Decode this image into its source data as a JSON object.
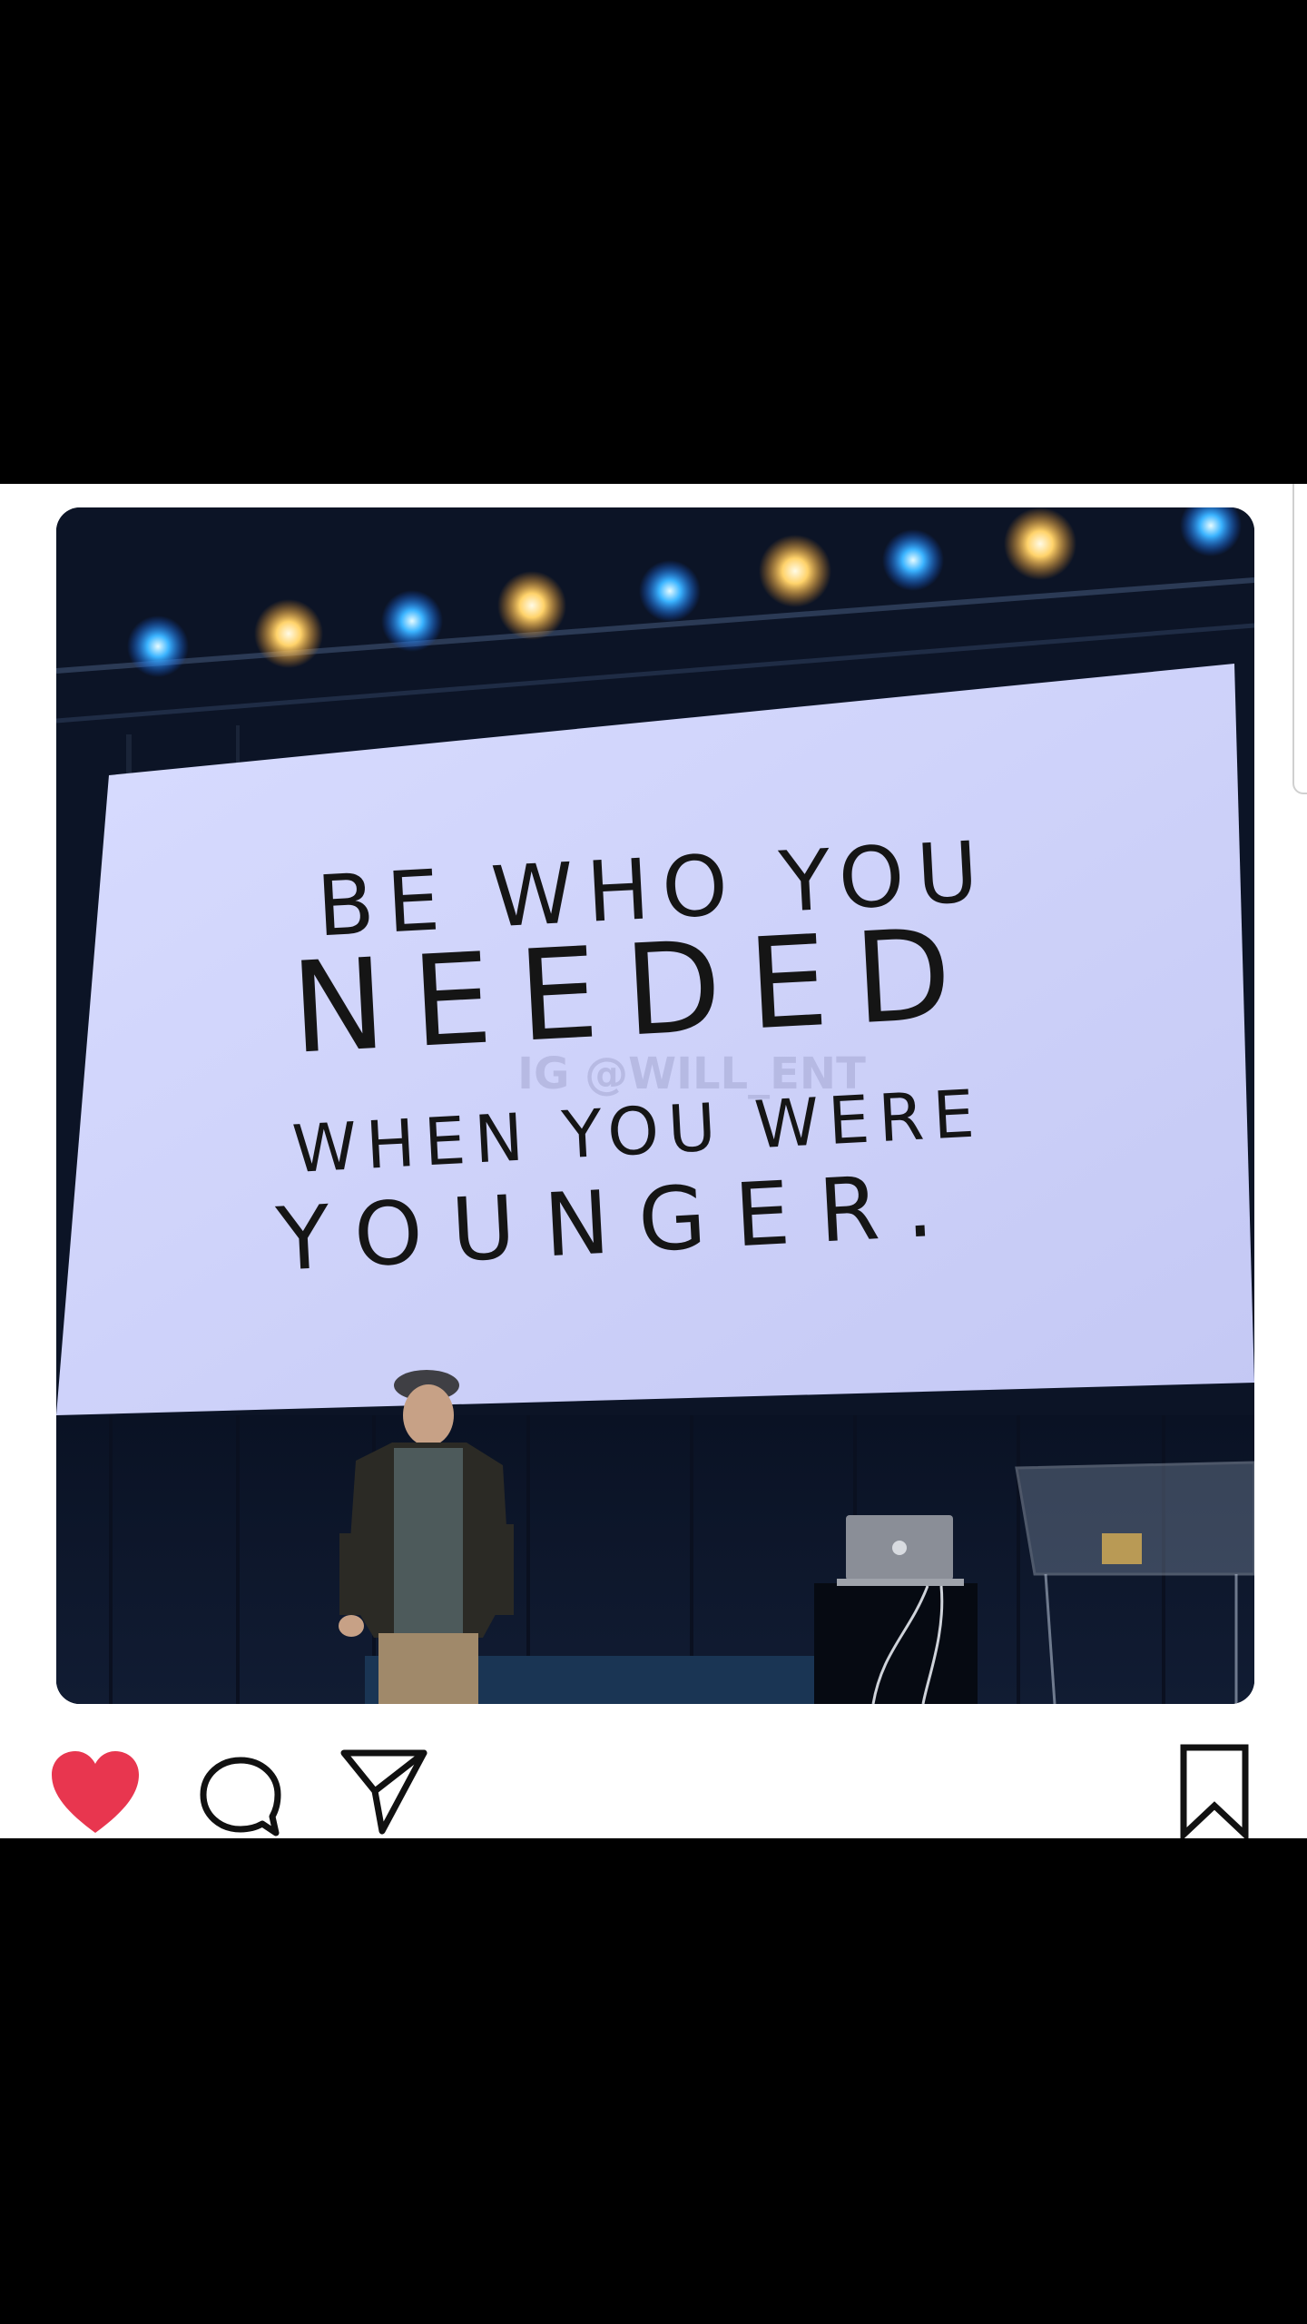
{
  "post": {
    "image": {
      "screen_lines": [
        "BE WHO YOU",
        "NEEDED",
        "WHEN YOU WERE",
        "YOUNGER."
      ],
      "watermark": "IG @WILL_ENT"
    },
    "actions": {
      "like_icon": "heart-filled",
      "comment_icon": "speech-bubble",
      "share_icon": "paper-plane",
      "save_icon": "bookmark",
      "like_color": "#e8364f"
    }
  }
}
